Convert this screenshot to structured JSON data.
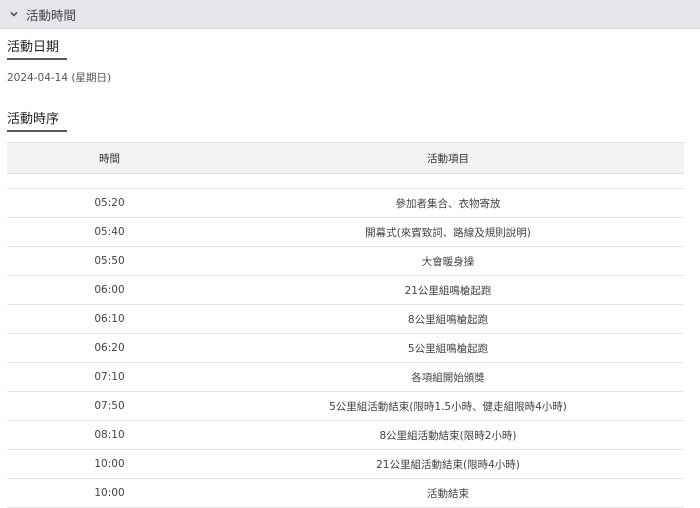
{
  "section": {
    "title": "活動時間"
  },
  "date_section": {
    "title": "活動日期",
    "date": "2024-04-14 (星期日)"
  },
  "schedule": {
    "title": "活動時序",
    "columns": {
      "time": "時間",
      "item": "活動項目"
    },
    "rows": [
      {
        "time": "05:20",
        "item": "參加者集合、衣物寄放"
      },
      {
        "time": "05:40",
        "item": "開幕式(來賓致詞、路線及規則說明)"
      },
      {
        "time": "05:50",
        "item": "大會暖身操"
      },
      {
        "time": "06:00",
        "item": "21公里組鳴槍起跑"
      },
      {
        "time": "06:10",
        "item": "8公里組鳴槍起跑"
      },
      {
        "time": "06:20",
        "item": "5公里組鳴槍起跑"
      },
      {
        "time": "07:10",
        "item": "各項組開始頒獎"
      },
      {
        "time": "07:50",
        "item": "5公里組活動結束(限時1.5小時、健走組限時4小時)"
      },
      {
        "time": "08:10",
        "item": "8公里組活動結束(限時2小時)"
      },
      {
        "time": "10:00",
        "item": "21公里組活動結束(限時4小時)"
      },
      {
        "time": "10:00",
        "item": "活動結束"
      }
    ]
  }
}
